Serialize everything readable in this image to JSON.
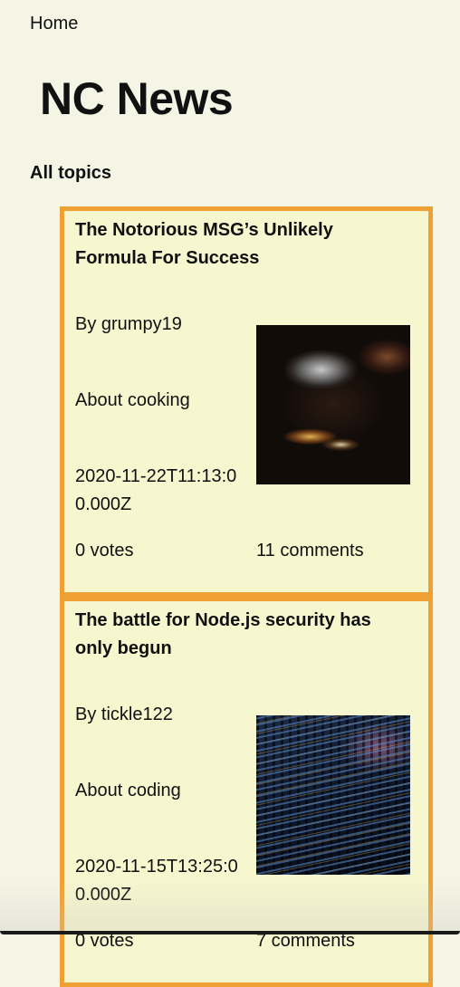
{
  "nav": {
    "home_label": "Home"
  },
  "header": {
    "title": "NC News"
  },
  "topics": {
    "label": "All topics"
  },
  "articles": [
    {
      "title": "The Notorious MSG’s Unlikely Formula For Success",
      "author": "By grumpy19",
      "topic": "About cooking",
      "created_at": "2020-11-22T11:13:00.000Z",
      "votes": "0 votes",
      "comments": "11 comments",
      "image_subject": "cooking-photo"
    },
    {
      "title": "The battle for Node.js security has only begun",
      "author": "By tickle122",
      "topic": "About coding",
      "created_at": "2020-11-15T13:25:00.000Z",
      "votes": "0 votes",
      "comments": "7 comments",
      "image_subject": "code-screen-photo"
    }
  ],
  "colors": {
    "page_background": "#f5f5e6",
    "card_background": "#f6f6cf",
    "card_border": "#efa032"
  }
}
